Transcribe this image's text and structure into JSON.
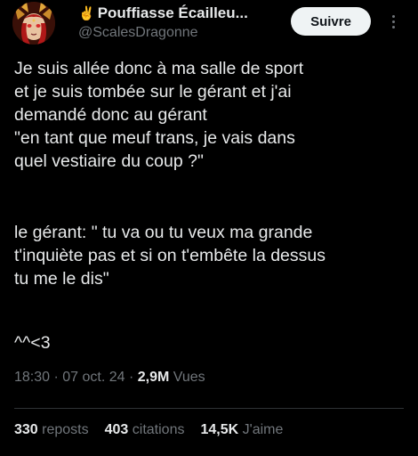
{
  "author": {
    "display_name": "Pouffiasse Écailleu...",
    "handle": "@ScalesDragonne",
    "name_emoji": "✌️"
  },
  "follow_label": "Suivre",
  "tweet": {
    "paragraph1": "Je suis allée donc à ma salle de sport\net je suis tombée sur le gérant et j'ai\ndemandé donc au gérant\n\"en tant que meuf trans, je vais dans\nquel vestiaire du coup ?\"",
    "paragraph2": "le gérant: \" tu va ou tu veux ma grande\nt'inquiète pas et si on t'embête la dessus\ntu me le dis\"",
    "paragraph3": "^^<3"
  },
  "meta": {
    "time": "18:30",
    "date": "07 oct. 24",
    "separator": " · ",
    "views_count": "2,9M",
    "views_label": "Vues"
  },
  "stats": {
    "reposts_count": "330",
    "reposts_label": "reposts",
    "quotes_count": "403",
    "quotes_label": "citations",
    "likes_count": "14,5K",
    "likes_label": "J'aime"
  },
  "colors": {
    "background": "#000000",
    "text": "#e7e9ea",
    "secondary": "#71767b",
    "button_bg": "#eff3f4",
    "divider": "#2f3336"
  }
}
